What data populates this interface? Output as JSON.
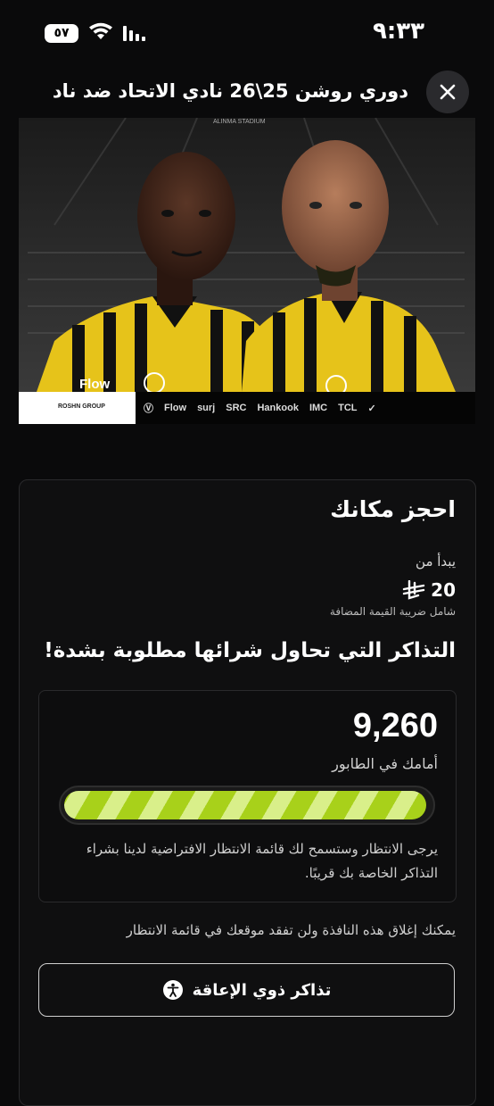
{
  "status_bar": {
    "time": "٩:٣٣",
    "battery": "٥٧",
    "wifi_icon": "wifi-icon",
    "signal_icon": "signal-icon"
  },
  "header": {
    "title": "دوري روشن 25\\26 نادي الاتحاد ضد ناد...",
    "close_icon": "close-icon"
  },
  "hero": {
    "stadium_text": "ALINMA STADIUM",
    "jersey_text": "Flow",
    "sponsors": [
      "ROSHN GROUP",
      "Flow",
      "surj",
      "SRC",
      "Hankook",
      "IMC",
      "TCL"
    ]
  },
  "booking": {
    "title": "احجز مكانك",
    "starts_from": "يبدأ من",
    "price": "20",
    "currency_icon": "riyal-icon",
    "vat_note": "شامل ضريبة القيمة المضافة",
    "demand_heading": "التذاكر التي تحاول شرائها مطلوبة بشدة!"
  },
  "queue": {
    "count": "9,260",
    "label": "أمامك في الطابور",
    "progress": 0.99,
    "note": "يرجى الانتظار وستسمح لك قائمة الانتظار الافتراضية لدينا بشراء التذاكر الخاصة بك قريبًا."
  },
  "close_note": "يمكنك إغلاق هذه النافذة ولن تفقد موقعك في قائمة الانتظار",
  "accessibility_button": {
    "label": "تذاكر ذوي الإعاقة",
    "icon": "accessibility-icon"
  },
  "colors": {
    "background": "#0a0a0b",
    "progress_dark": "#a8d11a",
    "progress_light": "#d9ef8a"
  }
}
